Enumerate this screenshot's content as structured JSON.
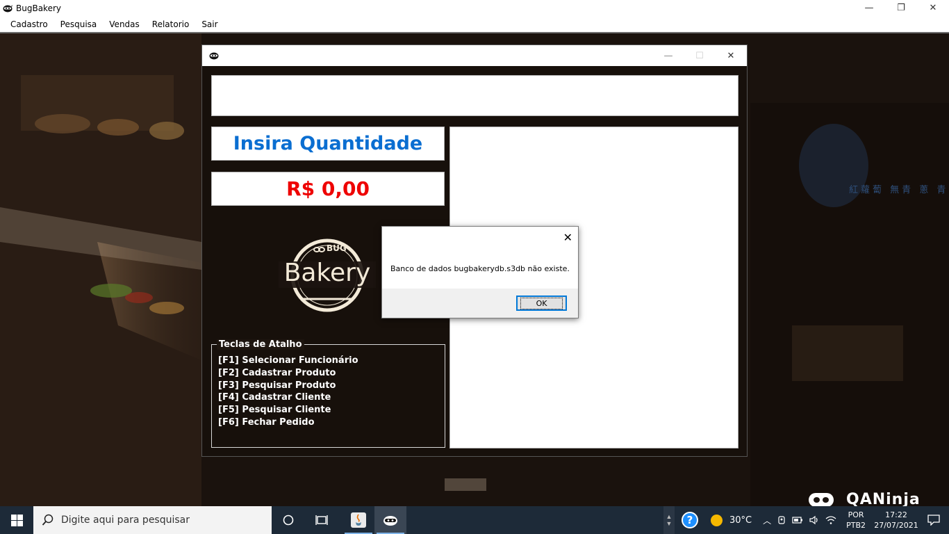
{
  "window": {
    "title": "BugBakery",
    "minimize": "—",
    "maximize": "❐",
    "close": "✕"
  },
  "menu": [
    "Cadastro",
    "Pesquisa",
    "Vendas",
    "Relatorio",
    "Sair"
  ],
  "child_window": {
    "minimize": "—",
    "maximize": "☐",
    "close": "✕",
    "quantity_label": "Insira Quantidade",
    "price_label": "R$ 0,00",
    "shortcuts": {
      "legend": "Teclas de Atalho",
      "items": [
        "[F1] Selecionar Funcionário",
        "[F2] Cadastrar Produto",
        "[F3] Pesquisar Produto",
        "[F4] Cadastrar Cliente",
        "[F5] Pesquisar Cliente",
        "[F6] Fechar Pedido"
      ]
    },
    "logo": {
      "small_text": "BUG",
      "main_text": "Bakery"
    }
  },
  "message_box": {
    "close": "✕",
    "message": "Banco de dados bugbakerydb.s3db não existe.",
    "ok_label": "OK"
  },
  "background": {
    "brand": "QANinja",
    "sign_text": "紅蘿蔔 無青 蔥 青"
  },
  "taskbar": {
    "search_placeholder": "Digite aqui para pesquisar",
    "temperature": "30°C",
    "language": "POR",
    "keyboard": "PTB2",
    "time": "17:22",
    "date": "27/07/2021"
  },
  "colors": {
    "quantity_text": "#0a6ed1",
    "price_text": "#ee0000",
    "taskbar": "#1d2a38"
  }
}
